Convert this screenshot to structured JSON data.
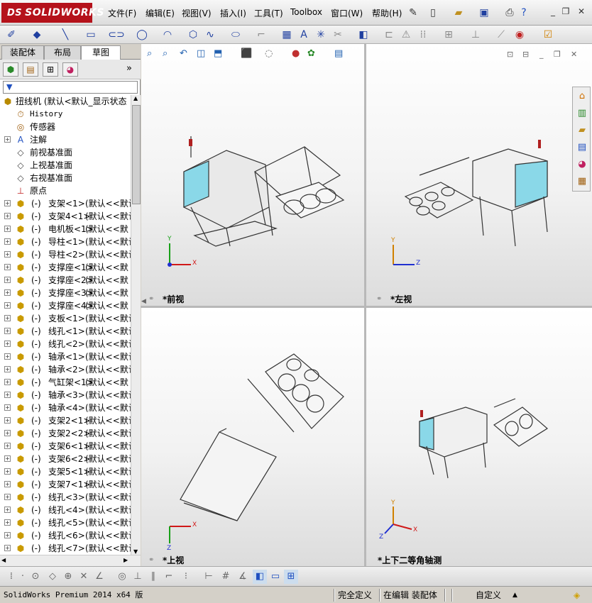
{
  "logo": {
    "mark": "DS",
    "name": "SOLIDWORKS"
  },
  "menu": [
    {
      "label": "文件(F)"
    },
    {
      "label": "编辑(E)"
    },
    {
      "label": "视图(V)"
    },
    {
      "label": "插入(I)"
    },
    {
      "label": "工具(T)"
    },
    {
      "label": "Toolbox"
    },
    {
      "label": "窗口(W)"
    },
    {
      "label": "帮助(H)"
    }
  ],
  "panel": {
    "tabs": [
      {
        "label": "装配体"
      },
      {
        "label": "布局"
      },
      {
        "label": "草图"
      }
    ],
    "active_tab": "草图",
    "filter_icon": "funnel-icon"
  },
  "tree": {
    "root": "扭线机  (默认<默认_显示状态",
    "fixed": [
      {
        "label": "History",
        "icon": "history-icon"
      },
      {
        "label": "传感器",
        "icon": "sensor-icon"
      },
      {
        "label": "注解",
        "icon": "annotation-icon"
      },
      {
        "label": "前视基准面",
        "icon": "plane-icon"
      },
      {
        "label": "上视基准面",
        "icon": "plane-icon"
      },
      {
        "label": "右视基准面",
        "icon": "plane-icon"
      },
      {
        "label": "原点",
        "icon": "origin-icon"
      }
    ],
    "parts": [
      {
        "prefix": "(-)",
        "name": "支架<1>",
        "config": "(默认<<默认"
      },
      {
        "prefix": "(-)",
        "name": "支架4<1>",
        "config": "(默认<<默认"
      },
      {
        "prefix": "(-)",
        "name": "电机板<1>",
        "config": "(默认<<默"
      },
      {
        "prefix": "(-)",
        "name": "导柱<1>",
        "config": "(默认<<默认"
      },
      {
        "prefix": "(-)",
        "name": "导柱<2>",
        "config": "(默认<<默认"
      },
      {
        "prefix": "(-)",
        "name": "支撑座<1>",
        "config": "(默认<<默"
      },
      {
        "prefix": "(-)",
        "name": "支撑座<2>",
        "config": "(默认<<默"
      },
      {
        "prefix": "(-)",
        "name": "支撑座<3>",
        "config": "(默认<<默"
      },
      {
        "prefix": "(-)",
        "name": "支撑座<4>",
        "config": "(默认<<默"
      },
      {
        "prefix": "(-)",
        "name": "支板<1>",
        "config": "(默认<<默认"
      },
      {
        "prefix": "(-)",
        "name": "线孔<1>",
        "config": "(默认<<默认"
      },
      {
        "prefix": "(-)",
        "name": "线孔<2>",
        "config": "(默认<<默认"
      },
      {
        "prefix": "(-)",
        "name": "轴承<1>",
        "config": "(默认<<默认"
      },
      {
        "prefix": "(-)",
        "name": "轴承<2>",
        "config": "(默认<<默认"
      },
      {
        "prefix": "(-)",
        "name": "气缸架<1>",
        "config": "(默认<<默"
      },
      {
        "prefix": "(-)",
        "name": "轴承<3>",
        "config": "(默认<<默认"
      },
      {
        "prefix": "(-)",
        "name": "轴承<4>",
        "config": "(默认<<默认"
      },
      {
        "prefix": "(-)",
        "name": "支架2<1>",
        "config": "(默认<<默认"
      },
      {
        "prefix": "(-)",
        "name": "支架2<2>",
        "config": "(默认<<默认"
      },
      {
        "prefix": "(-)",
        "name": "支架6<1>",
        "config": "(默认<<默认"
      },
      {
        "prefix": "(-)",
        "name": "支架6<2>",
        "config": "(默认<<默认"
      },
      {
        "prefix": "(-)",
        "name": "支架5<1>",
        "config": "(默认<<默认"
      },
      {
        "prefix": "(-)",
        "name": "支架7<1>",
        "config": "(默认<<默认"
      },
      {
        "prefix": "(-)",
        "name": "线孔<3>",
        "config": "(默认<<默认"
      },
      {
        "prefix": "(-)",
        "name": "线孔<4>",
        "config": "(默认<<默认"
      },
      {
        "prefix": "(-)",
        "name": "线孔<5>",
        "config": "(默认<<默认"
      },
      {
        "prefix": "(-)",
        "name": "线孔<6>",
        "config": "(默认<<默认"
      },
      {
        "prefix": "(-)",
        "name": "线孔<7>",
        "config": "(默认<<默认"
      }
    ]
  },
  "viewports": {
    "front": {
      "label": "*前视",
      "axes": [
        "Y",
        "X"
      ]
    },
    "left": {
      "label": "*左视",
      "axes": [
        "Y",
        "Z"
      ]
    },
    "top": {
      "label": "*上视",
      "axes": [
        "X",
        "Z"
      ]
    },
    "iso": {
      "label": "*上下二等角轴测",
      "axes": [
        "Y",
        "Z",
        "X"
      ]
    }
  },
  "status": {
    "product": "SolidWorks Premium 2014 x64 版",
    "definition": "完全定义",
    "mode": "在编辑 装配体",
    "units": "自定义"
  },
  "colors": {
    "brand": "#b5121b",
    "axis_x": "#d01818",
    "axis_y": "#18a018",
    "axis_z": "#2030d0",
    "panel_cyan": "#8ad8e8"
  }
}
